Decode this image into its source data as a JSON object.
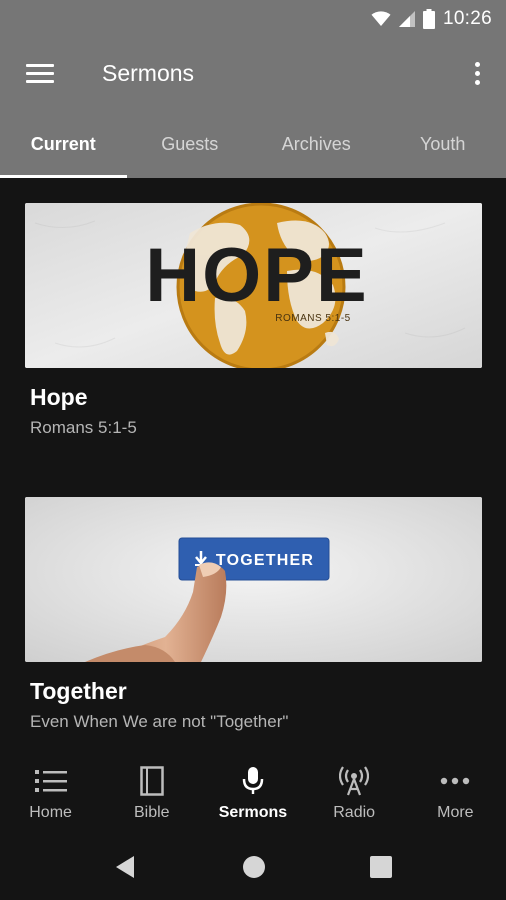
{
  "status_bar": {
    "time": "10:26"
  },
  "app_bar": {
    "title": "Sermons"
  },
  "tabs": [
    {
      "label": "Current",
      "active": true
    },
    {
      "label": "Guests",
      "active": false
    },
    {
      "label": "Archives",
      "active": false
    },
    {
      "label": "Youth",
      "active": false
    }
  ],
  "sermons": [
    {
      "title": "Hope",
      "subtitle": "Romans 5:1-5",
      "image_heading": "HOPE",
      "image_reference": "ROMANS 5:1-5"
    },
    {
      "title": "Together",
      "subtitle": "Even When We are not \"Together\"",
      "image_button": "TOGETHER"
    }
  ],
  "bottom_nav": [
    {
      "label": "Home",
      "icon": "list-icon",
      "active": false
    },
    {
      "label": "Bible",
      "icon": "book-icon",
      "active": false
    },
    {
      "label": "Sermons",
      "icon": "microphone-icon",
      "active": true
    },
    {
      "label": "Radio",
      "icon": "radio-tower-icon",
      "active": false
    },
    {
      "label": "More",
      "icon": "more-horizontal-icon",
      "active": false
    }
  ],
  "colors": {
    "app_bar": "#767676",
    "background": "#141414",
    "globe": "#d4931e",
    "button_blue": "#2f5fb0"
  }
}
